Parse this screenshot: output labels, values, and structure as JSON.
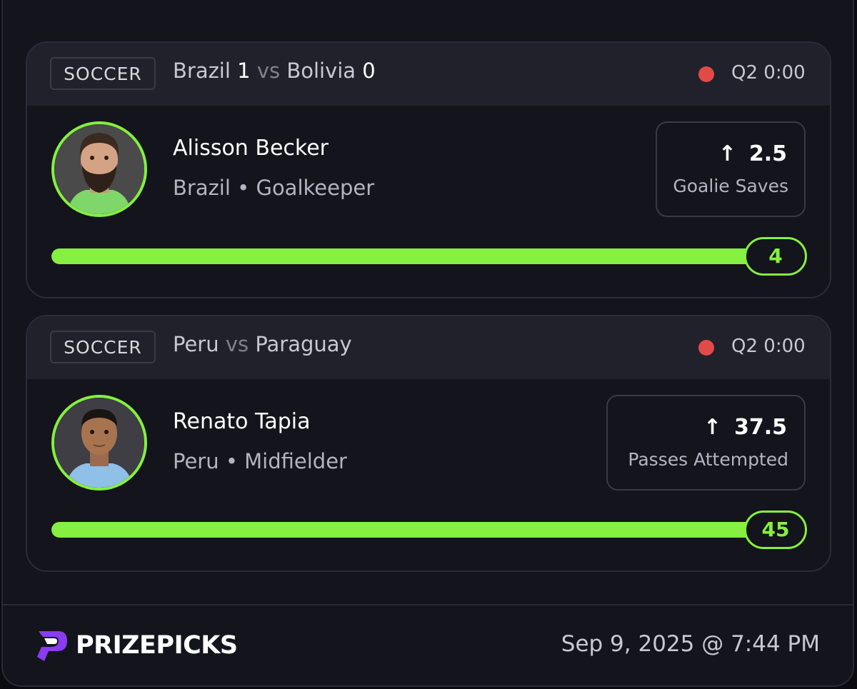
{
  "cards": [
    {
      "sport": "SOCCER",
      "home_team": "Brazil",
      "home_score": "1",
      "vs": "vs",
      "away_team": "Bolivia",
      "away_score": "0",
      "clock": "Q2 0:00",
      "player_name": "Alisson Becker",
      "player_meta": "Brazil • Goalkeeper",
      "line_arrow": "↑",
      "line_value": "2.5",
      "line_stat": "Goalie Saves",
      "result": "4",
      "progress": 1.0
    },
    {
      "sport": "SOCCER",
      "home_team": "Peru",
      "home_score": "",
      "vs": "vs",
      "away_team": "Paraguay",
      "away_score": "",
      "clock": "Q2 0:00",
      "player_name": "Renato Tapia",
      "player_meta": "Peru • Midfielder",
      "line_arrow": "↑",
      "line_value": "37.5",
      "line_stat": "Passes Attempted",
      "result": "45",
      "progress": 1.0
    }
  ],
  "footer": {
    "brand": "PRIZEPICKS",
    "timestamp": "Sep 9, 2025 @ 7:44 PM"
  },
  "colors": {
    "accent": "#85f03f",
    "live": "#e24a4a",
    "logo": "#8a3cf0"
  }
}
